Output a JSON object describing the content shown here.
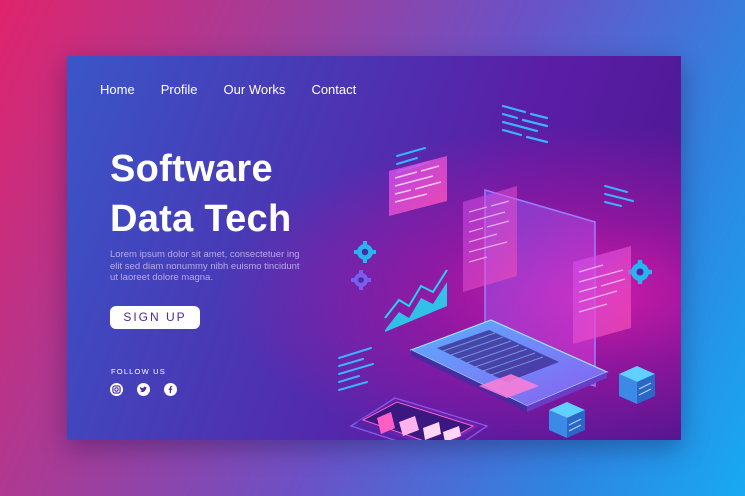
{
  "nav": {
    "items": [
      "Home",
      "Profile",
      "Our Works",
      "Contact"
    ]
  },
  "hero": {
    "title_line1": "Software",
    "title_line2": "Data Tech",
    "body": "Lorem ipsum dolor sit amet, consectetuer ing elit sed diam nonummy nibh euismo tincidunt ut laoreet dolore magna.",
    "cta_label": "SIGN UP"
  },
  "social": {
    "heading": "FOLLOW US",
    "icons": [
      "instagram-icon",
      "twitter-icon",
      "facebook-icon"
    ]
  },
  "colors": {
    "accent_cyan": "#27d3f0",
    "accent_magenta": "#e640e6",
    "card_blue": "#3a56c8",
    "card_purple": "#5a1ea6"
  }
}
